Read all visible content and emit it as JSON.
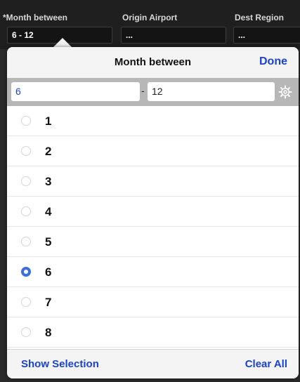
{
  "filters": [
    {
      "label": "*Month between",
      "value": "6 - 12"
    },
    {
      "label": "Origin Airport",
      "value": "..."
    },
    {
      "label": "Dest Region",
      "value": "..."
    }
  ],
  "popover": {
    "title": "Month between",
    "done_label": "Done",
    "range": {
      "from": "6",
      "separator": "-",
      "to": "12"
    },
    "settings_icon": "gear-icon",
    "options": [
      {
        "label": "1",
        "selected": false
      },
      {
        "label": "2",
        "selected": false
      },
      {
        "label": "3",
        "selected": false
      },
      {
        "label": "4",
        "selected": false
      },
      {
        "label": "5",
        "selected": false
      },
      {
        "label": "6",
        "selected": true
      },
      {
        "label": "7",
        "selected": false
      },
      {
        "label": "8",
        "selected": false
      }
    ],
    "footer": {
      "show_selection": "Show Selection",
      "clear_all": "Clear All"
    }
  },
  "colors": {
    "accent": "#1942d6",
    "radio_selected": "#3a6fe0"
  }
}
